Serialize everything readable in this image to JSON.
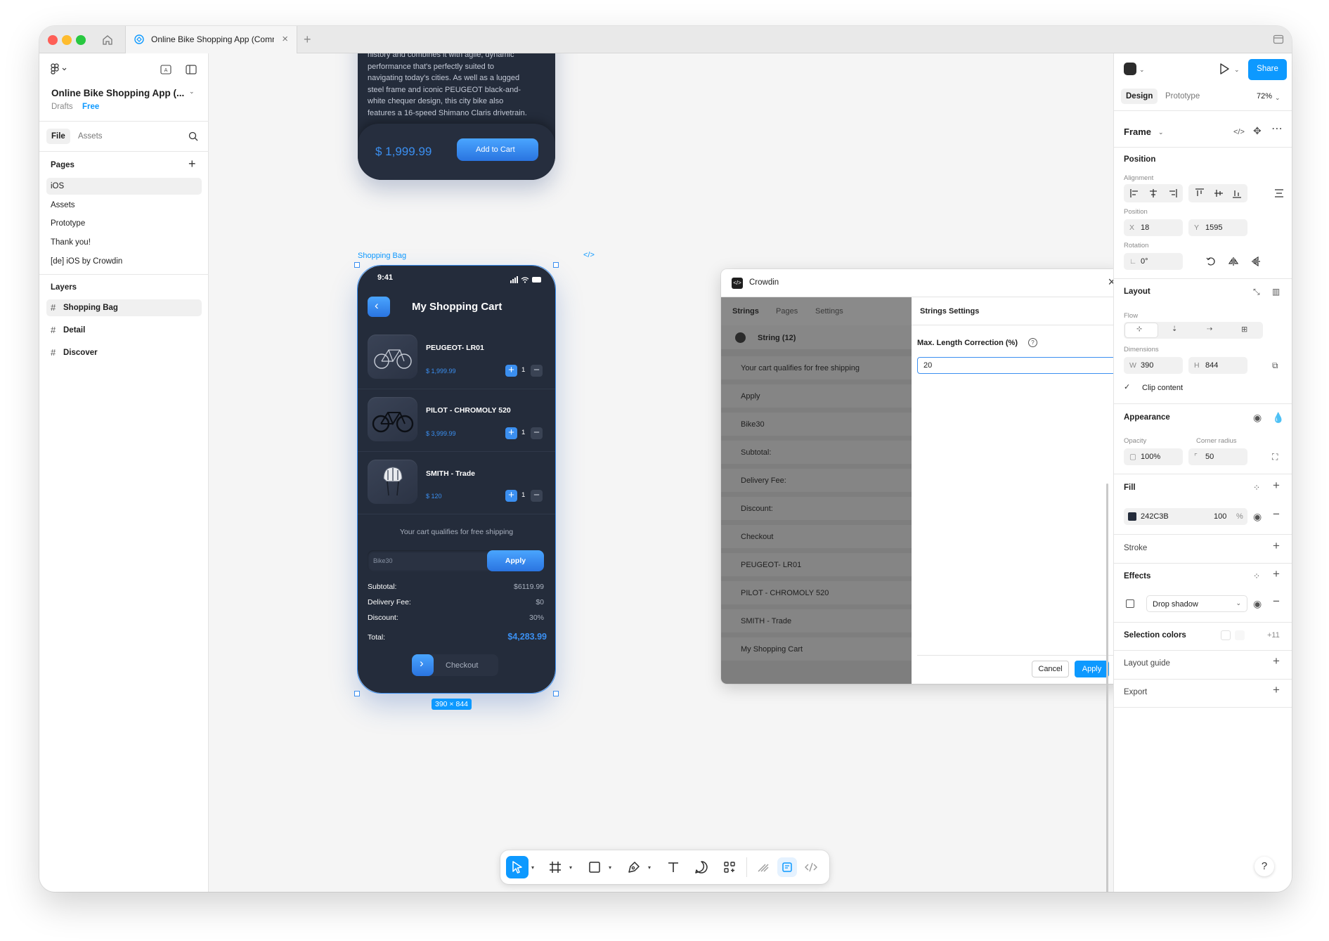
{
  "window": {
    "tab_title": "Online Bike Shopping App (Comm",
    "colors": {
      "accent": "#0d99ff",
      "traffic_red": "#fe5f57",
      "traffic_yellow": "#febc2e",
      "traffic_green": "#28c840"
    }
  },
  "left_panel": {
    "file_name": "Online Bike Shopping App (...",
    "drafts": "Drafts",
    "plan": "Free",
    "tabs": {
      "file": "File",
      "assets": "Assets"
    },
    "pages_title": "Pages",
    "pages": [
      "iOS",
      "Assets",
      "Prototype",
      "Thank you!",
      "[de] iOS by Crowdin"
    ],
    "layers_title": "Layers",
    "layers": [
      "Shopping Bag",
      "Detail",
      "Discover"
    ]
  },
  "canvas": {
    "top_phone": {
      "description_lines": [
        "history and combines it with agile, dynamic",
        "performance that's perfectly suited to",
        "navigating today's cities. As well as a lugged",
        "steel frame and iconic PEUGEOT black-and-",
        "white chequer design, this city bike also",
        "features a 16-speed Shimano Claris drivetrain."
      ],
      "price": "$ 1,999.99",
      "add_to_cart": "Add to Cart"
    },
    "frame_label": "Shopping Bag",
    "frame_size": "390 × 844",
    "cart": {
      "time": "9:41",
      "title": "My Shopping Cart",
      "items": [
        {
          "name": "PEUGEOT- LR01",
          "price": "$ 1,999.99",
          "qty": "1"
        },
        {
          "name": "PILOT - CHROMOLY 520",
          "price": "$ 3,999.99",
          "qty": "1"
        },
        {
          "name": "SMITH - Trade",
          "price": "$ 120",
          "qty": "1"
        }
      ],
      "free_shipping": "Your cart qualifies for free shipping",
      "coupon_code": "Bike30",
      "apply": "Apply",
      "summary": [
        {
          "label": "Subtotal:",
          "value": "$6119.99"
        },
        {
          "label": "Delivery Fee:",
          "value": "$0"
        },
        {
          "label": "Discount:",
          "value": "30%"
        }
      ],
      "total_label": "Total:",
      "total_value": "$4,283.99",
      "checkout": "Checkout",
      "colors": {
        "background": "#242c3b",
        "accent": "#3b8ff0"
      }
    }
  },
  "dialog": {
    "title": "Crowdin",
    "tabs": [
      "Strings",
      "Pages",
      "Settings"
    ],
    "string_count": "String (12)",
    "strings": [
      "Your cart qualifies for free shipping",
      "Apply",
      "Bike30",
      "Subtotal:",
      "Delivery Fee:",
      "Discount:",
      "Checkout",
      "PEUGEOT- LR01",
      "PILOT - CHROMOLY 520",
      "SMITH - Trade",
      "My Shopping Cart"
    ],
    "settings_title": "Strings Settings",
    "field_label": "Max. Length Correction (%)",
    "field_value": "20",
    "cancel": "Cancel",
    "apply": "Apply"
  },
  "right_panel": {
    "share": "Share",
    "tabs": {
      "design": "Design",
      "prototype": "Prototype"
    },
    "zoom": "72%",
    "frame_title": "Frame",
    "position": {
      "title": "Position",
      "alignment_label": "Alignment",
      "position_label": "Position",
      "x_label": "X",
      "x": "18",
      "y_label": "Y",
      "y": "1595",
      "rotation_label": "Rotation",
      "rotation": "0°"
    },
    "layout": {
      "title": "Layout",
      "flow_label": "Flow",
      "dimensions_label": "Dimensions",
      "w_label": "W",
      "w": "390",
      "h_label": "H",
      "h": "844",
      "clip": "Clip content"
    },
    "appearance": {
      "title": "Appearance",
      "opacity_label": "Opacity",
      "opacity": "100%",
      "radius_label": "Corner radius",
      "radius": "50"
    },
    "fill": {
      "title": "Fill",
      "hex": "242C3B",
      "opacity": "100",
      "percent": "%",
      "swatch_color": "#242c3b"
    },
    "stroke": {
      "title": "Stroke"
    },
    "effects": {
      "title": "Effects",
      "effect": "Drop shadow"
    },
    "selection_colors": {
      "title": "Selection colors",
      "more": "+11"
    },
    "layout_guide": "Layout guide",
    "export": "Export"
  }
}
